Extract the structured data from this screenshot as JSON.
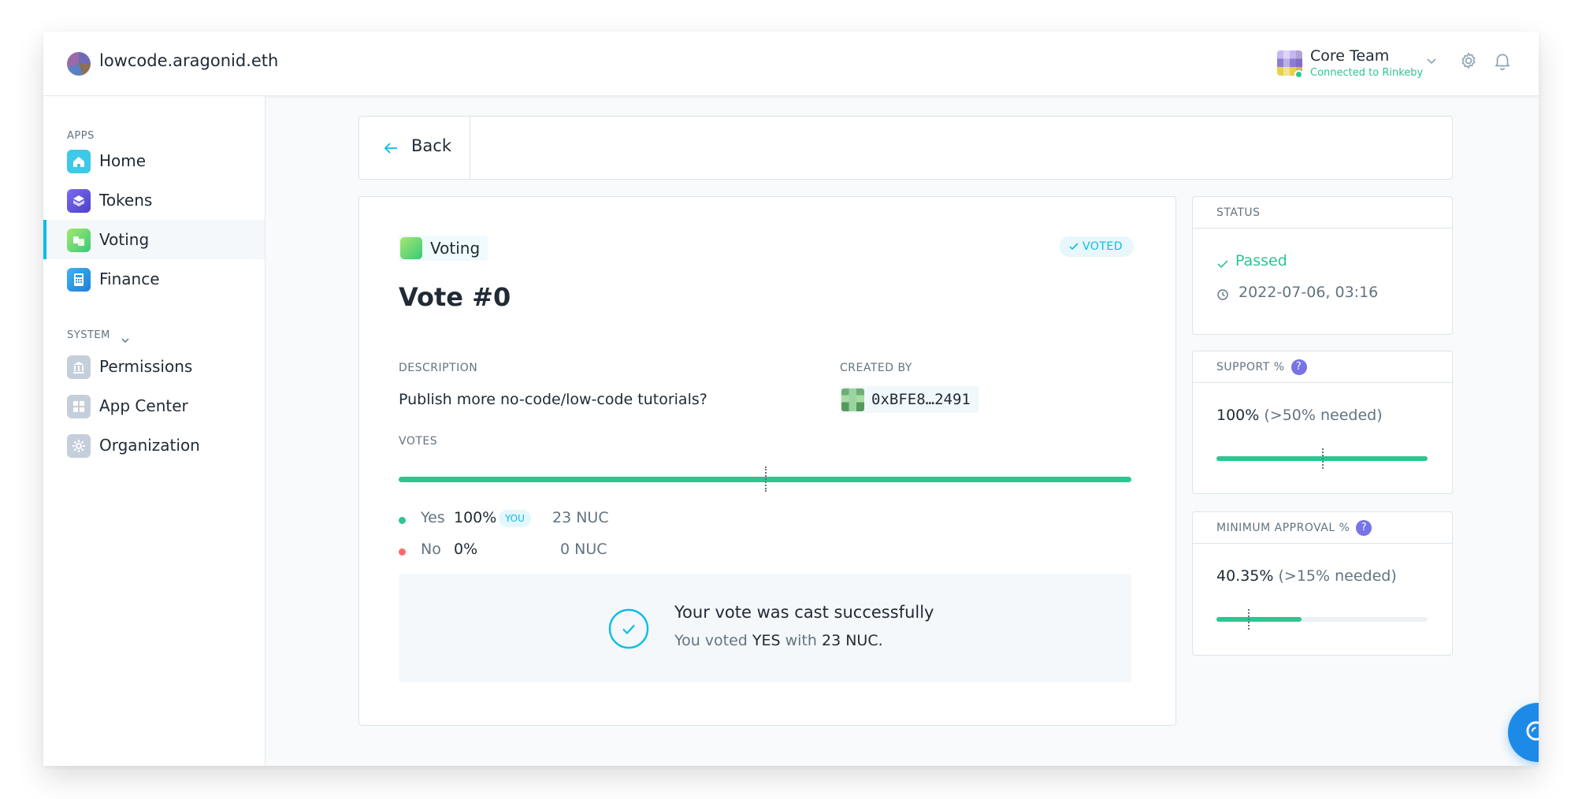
{
  "header": {
    "org_name": "lowcode.aragonid.eth",
    "account_name": "Core Team",
    "account_network": "Connected to Rinkeby"
  },
  "sidebar": {
    "apps_heading": "APPS",
    "system_heading": "SYSTEM",
    "apps": [
      {
        "label": "Home",
        "icon": "home-icon",
        "color": "#3dc9e8"
      },
      {
        "label": "Tokens",
        "icon": "tokens-icon",
        "color": "#6b53e0"
      },
      {
        "label": "Voting",
        "icon": "voting-icon",
        "color": "#58cf7e"
      },
      {
        "label": "Finance",
        "icon": "finance-icon",
        "color": "#2a9ae8"
      }
    ],
    "system": [
      {
        "label": "Permissions",
        "icon": "permissions-icon"
      },
      {
        "label": "App Center",
        "icon": "app-center-icon"
      },
      {
        "label": "Organization",
        "icon": "organization-icon"
      }
    ]
  },
  "back": {
    "label": "Back"
  },
  "vote": {
    "app_label": "Voting",
    "voted_badge": "VOTED",
    "title": "Vote #0",
    "description_heading": "DESCRIPTION",
    "description": "Publish more no-code/low-code tutorials?",
    "created_by_heading": "CREATED BY",
    "creator": "0xBFE8…2491",
    "votes_heading": "VOTES",
    "yes_fraction": 1.0,
    "support_required_fraction": 0.5,
    "options": [
      {
        "label": "Yes",
        "pct": "100%",
        "you": "YOU",
        "amount": "23 NUC",
        "color": "#2cc68f"
      },
      {
        "label": "No",
        "pct": "0%",
        "amount": "0 NUC",
        "color": "#ff6969"
      }
    ],
    "success_title": "Your vote was cast successfully",
    "success_prefix": "You voted",
    "success_choice": "YES",
    "success_with": "with",
    "success_amount": "23 NUC."
  },
  "status": {
    "heading": "STATUS",
    "result": "Passed",
    "datetime": "2022-07-06, 03:16"
  },
  "support": {
    "heading": "SUPPORT %",
    "help": "?",
    "value": "100%",
    "needed": "(>50% needed)",
    "fill_fraction": 1.0,
    "marker_fraction": 0.5
  },
  "approval": {
    "heading": "MINIMUM APPROVAL %",
    "help": "?",
    "value": "40.35%",
    "needed": "(>15% needed)",
    "fill_fraction": 0.4035,
    "marker_fraction": 0.15
  },
  "colors": {
    "accent": "#08bee5",
    "positive": "#2cc68f",
    "negative": "#ff6969",
    "fab": "#1e8ae8"
  }
}
